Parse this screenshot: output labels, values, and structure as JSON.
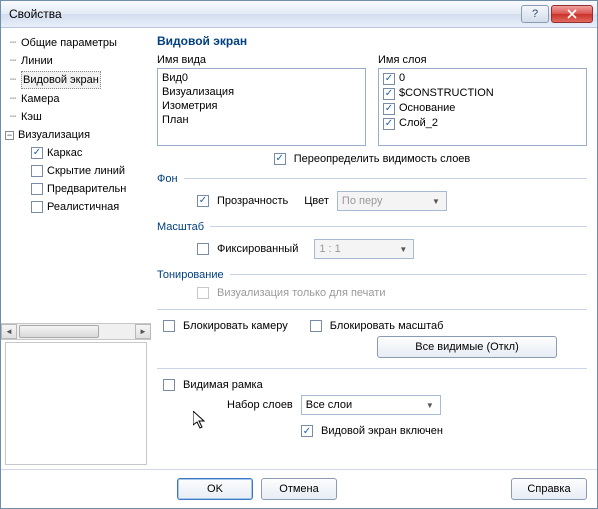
{
  "title": "Свойства",
  "tree": {
    "items": [
      "Общие параметры",
      "Линии",
      "Видовой экран",
      "Камера",
      "Кэш"
    ],
    "viz": "Визуализация",
    "viz_children": [
      {
        "label": "Каркас",
        "checked": true
      },
      {
        "label": "Скрытие линий",
        "checked": false
      },
      {
        "label": "Предварительн",
        "checked": false
      },
      {
        "label": "Реалистичная",
        "checked": false
      }
    ]
  },
  "content": {
    "heading": "Видовой экран",
    "view_name_label": "Имя вида",
    "views": [
      "Вид0",
      "Визуализация",
      "Изометрия",
      "План"
    ],
    "layer_name_label": "Имя слоя",
    "layers": [
      {
        "label": "0",
        "checked": true
      },
      {
        "label": "$CONSTRUCTION",
        "checked": true
      },
      {
        "label": "Основание",
        "checked": true
      },
      {
        "label": "Слой_2",
        "checked": true
      }
    ],
    "override_label": "Переопределить видимость слоев",
    "override_checked": true,
    "bg_group": "Фон",
    "transparency_label": "Прозрачность",
    "transparency_checked": true,
    "color_label": "Цвет",
    "color_value": "По перу",
    "scale_group": "Масштаб",
    "fixed_label": "Фиксированный",
    "fixed_checked": false,
    "scale_value": "1 : 1",
    "toning_group": "Тонирование",
    "print_only_label": "Визуализация только для печати",
    "lock_camera_label": "Блокировать камеру",
    "lock_camera_checked": false,
    "lock_scale_label": "Блокировать масштаб",
    "lock_scale_checked": false,
    "all_visible_btn": "Все видимые (Откл)",
    "visible_frame_label": "Видимая рамка",
    "visible_frame_checked": false,
    "layer_set_label": "Набор слоев",
    "layer_set_value": "Все слои",
    "viewport_on_label": "Видовой экран включен",
    "viewport_on_checked": true
  },
  "footer": {
    "ok": "OK",
    "cancel": "Отмена",
    "help": "Справка"
  }
}
